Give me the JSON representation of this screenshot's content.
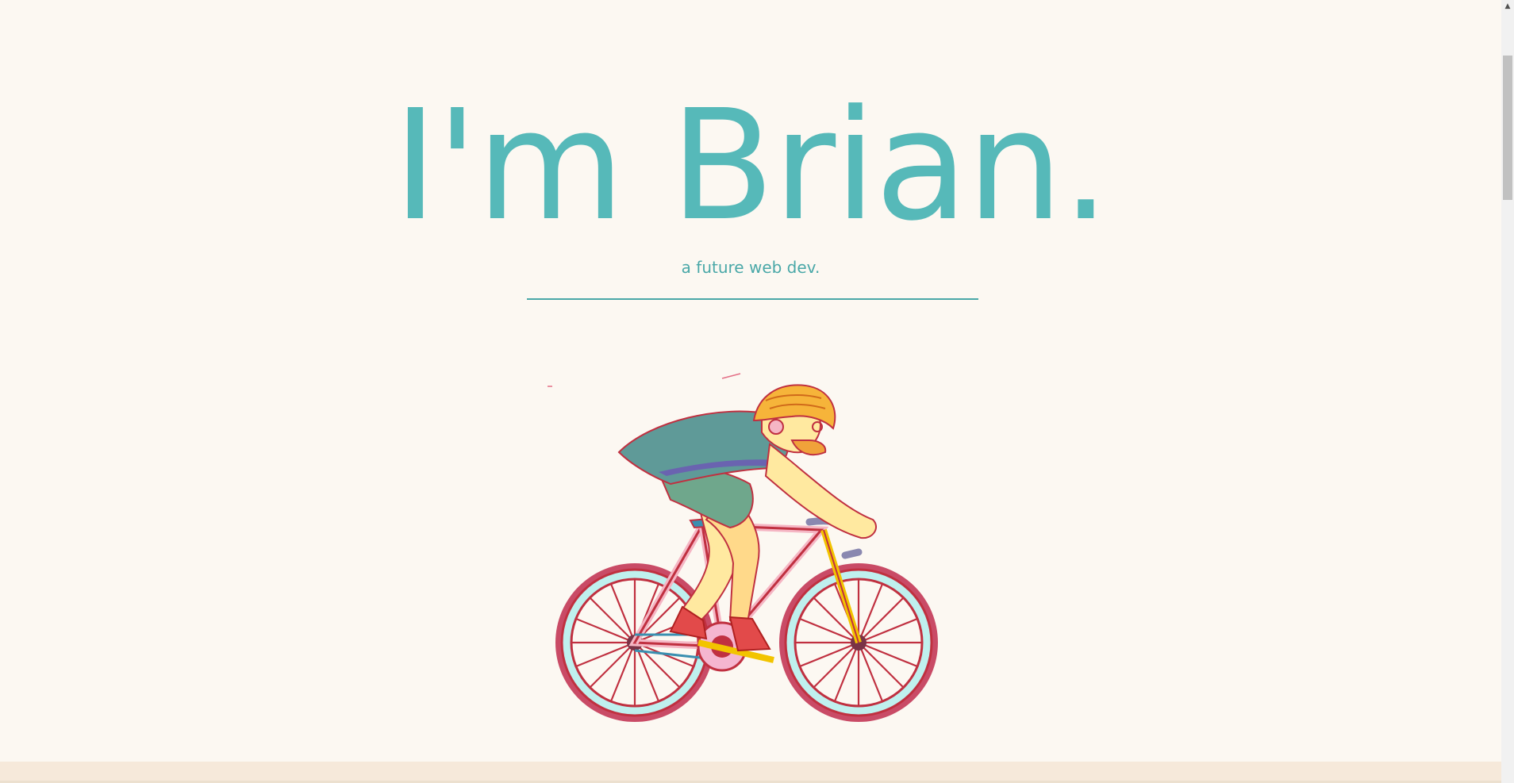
{
  "hero": {
    "title": "I'm Brian.",
    "subtitle": "a future web dev."
  },
  "illustration": {
    "name": "cyclist-illustration"
  },
  "scrollbar": {
    "up_arrow": "▲"
  },
  "colors": {
    "background": "#fcf8f2",
    "accent": "#56b9b9",
    "footer_band": "#f6e9da"
  }
}
